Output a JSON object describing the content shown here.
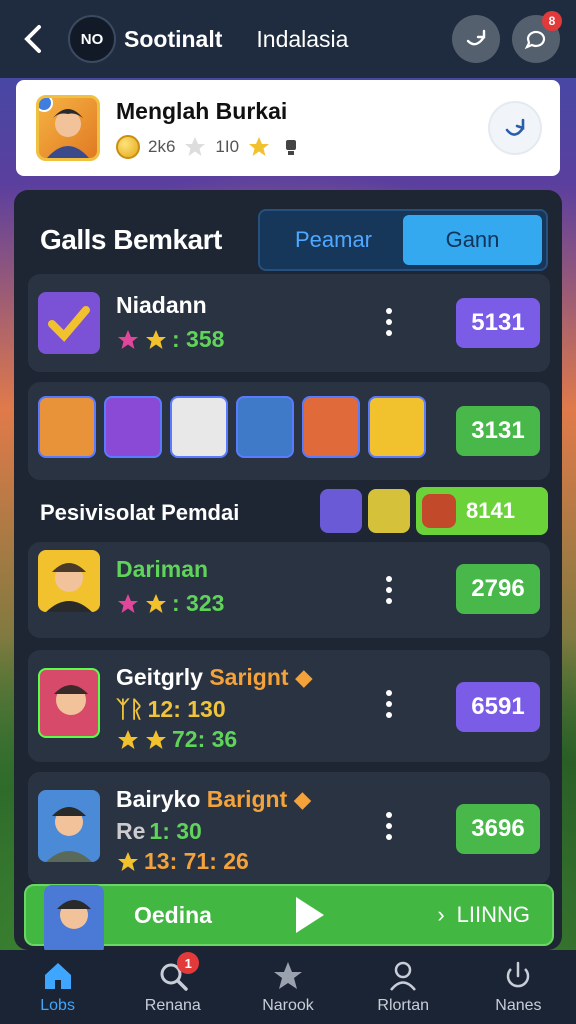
{
  "header": {
    "badge": "NO",
    "title": "Sootinalt",
    "subtitle": "Indalasia",
    "notification_count": "8"
  },
  "profile": {
    "name": "Menglah Burkai",
    "coin_text": "2k6",
    "star_text": "1I0"
  },
  "panel": {
    "title": "Galls Bemkart",
    "tabs": [
      {
        "label": "Peamar",
        "active": false
      },
      {
        "label": "Gann",
        "active": true
      }
    ]
  },
  "rows": [
    {
      "name": "Niadann",
      "stats": ": 358",
      "score": "5131",
      "score_color": "purple"
    },
    {
      "name": "",
      "stats": "",
      "score": "3131",
      "score_color": "green"
    }
  ],
  "section": {
    "label": "Pesivisolat Pemdai",
    "badge_value": "8141"
  },
  "players": [
    {
      "name": "Dariman",
      "name_color": "#5fd35a",
      "line1": ": 323",
      "score": "2796",
      "score_color": "green"
    },
    {
      "name": "Geitgrly",
      "suffix": "Sarignt",
      "line1_prefix": "ᛉᚱ",
      "line1": "12: 130",
      "line2": "72: 36",
      "score": "6591",
      "score_color": "purple"
    },
    {
      "name": "Bairyko",
      "suffix": "Barignt",
      "line1_prefix": "Re",
      "line1": "1: 30",
      "line2": "13: 71: 26",
      "score": "3696",
      "score_color": "green"
    }
  ],
  "playbar": {
    "label": "Oedina",
    "right_label": "LIINNG"
  },
  "bottom_nav": [
    {
      "label": "Lobs",
      "icon": "home-icon",
      "active": true
    },
    {
      "label": "Renana",
      "icon": "search-icon",
      "badge": "1"
    },
    {
      "label": "Narook",
      "icon": "star-icon"
    },
    {
      "label": "Rlortan",
      "icon": "person-icon"
    },
    {
      "label": "Nanes",
      "icon": "power-icon"
    }
  ]
}
